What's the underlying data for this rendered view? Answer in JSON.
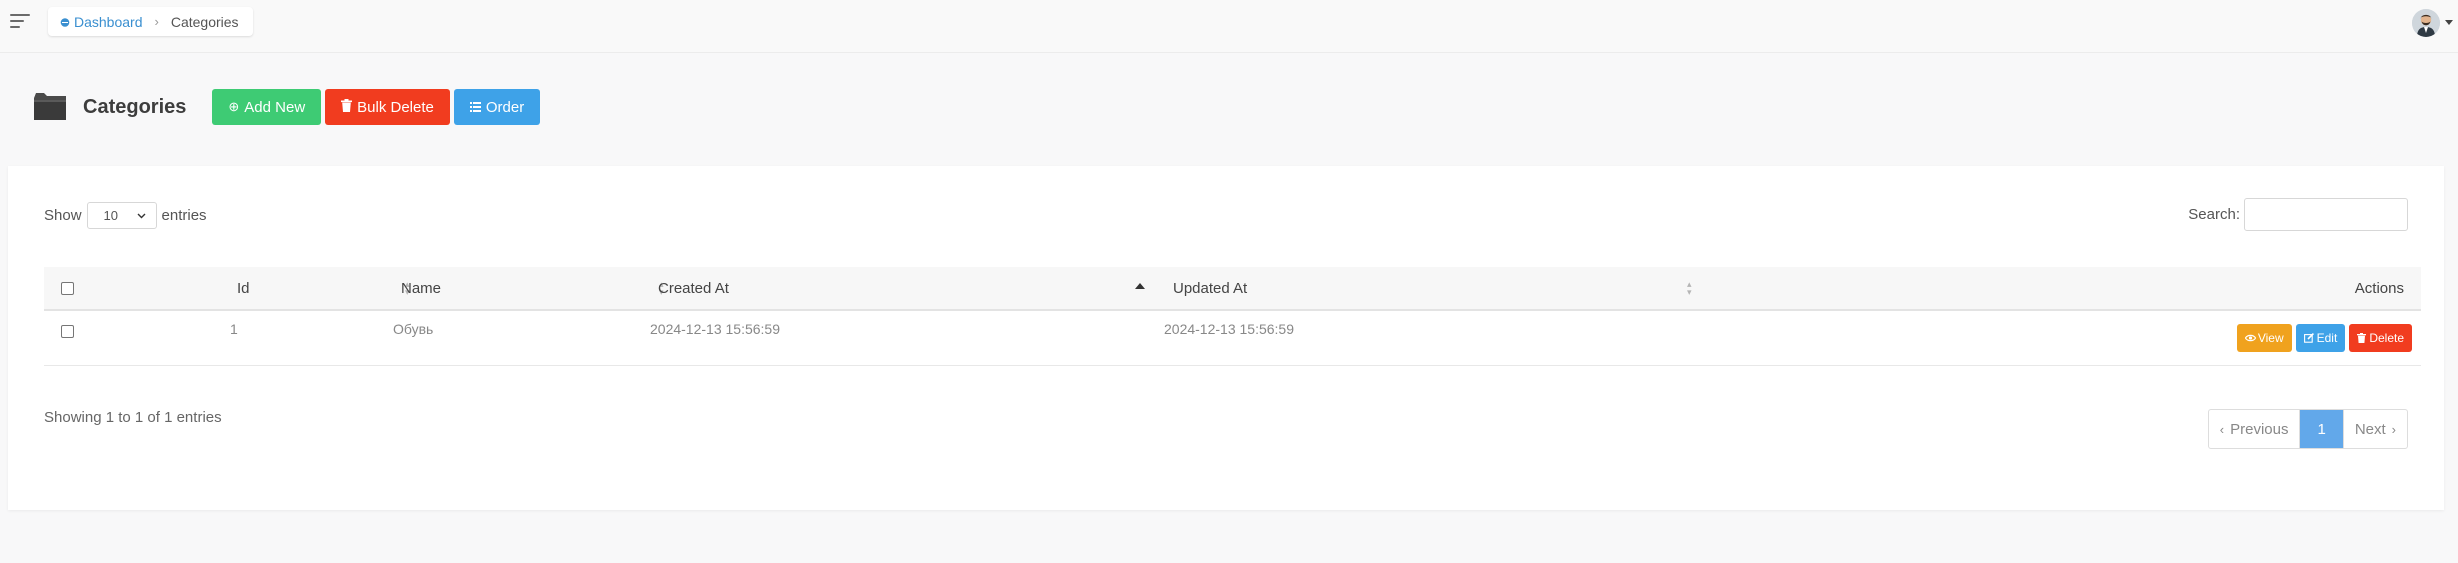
{
  "breadcrumb": {
    "home": "Dashboard",
    "current": "Categories"
  },
  "header": {
    "title": "Categories",
    "buttons": {
      "add_new": "Add New",
      "bulk_delete": "Bulk Delete",
      "order": "Order"
    }
  },
  "table_controls": {
    "show_label": "Show",
    "length_value": "10",
    "entries_label": "entries",
    "search_label": "Search:",
    "search_value": ""
  },
  "table": {
    "columns": [
      "Id",
      "Name",
      "Created At",
      "Updated At",
      "Actions"
    ],
    "sorted_column": "Created At",
    "sort_direction": "ascending",
    "rows": [
      {
        "id": "1",
        "name": "Обувь",
        "created_at": "2024-12-13 15:56:59",
        "updated_at": "2024-12-13 15:56:59"
      }
    ],
    "row_actions": {
      "view": "View",
      "edit": "Edit",
      "delete": "Delete"
    }
  },
  "footer": {
    "info": "Showing 1 to 1 of 1 entries",
    "pagination": {
      "previous": "Previous",
      "current_page": "1",
      "next": "Next"
    }
  },
  "colors": {
    "link": "#3a8fd0",
    "add_new": "#3ecb74",
    "delete": "#f13c1f",
    "primary": "#3ea2e8",
    "view": "#f0a21e",
    "active_page": "#62a8ea"
  }
}
